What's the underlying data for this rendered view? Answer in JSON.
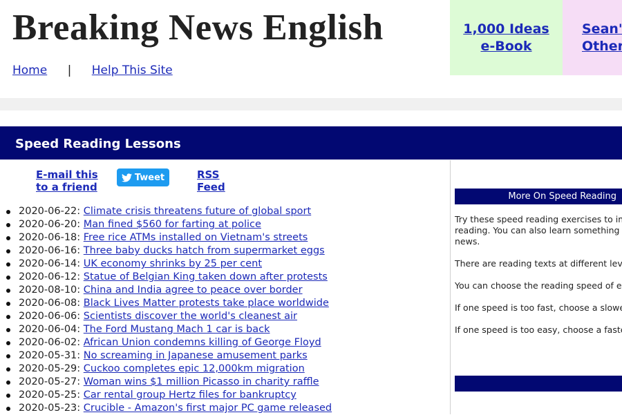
{
  "header": {
    "site_title": "Breaking News English",
    "nav": {
      "home": "Home",
      "separator": "|",
      "help": "Help This Site"
    },
    "promo_ideas": {
      "line1": "1,000 Ideas",
      "line2": "e-Book",
      "bg": "#ddfbd6"
    },
    "promo_sean": {
      "line1": "Sean'",
      "line2": "Other",
      "bg": "#f6ddf6"
    }
  },
  "section": {
    "title": "Speed Reading Lessons",
    "bg": "#020872"
  },
  "share": {
    "email": "E-mail this\nto a friend",
    "tweet": "Tweet",
    "tweet_icon": "twitter-bird-icon",
    "rss": "RSS\nFeed"
  },
  "lessons": [
    {
      "date": "2020-06-22:",
      "title": "Climate crisis threatens future of global sport"
    },
    {
      "date": "2020-06-20:",
      "title": "Man fined $560 for farting at police"
    },
    {
      "date": "2020-06-18:",
      "title": "Free rice ATMs installed on Vietnam's streets"
    },
    {
      "date": "2020-06-16:",
      "title": "Three baby ducks hatch from supermarket eggs"
    },
    {
      "date": "2020-06-14:",
      "title": "UK economy shrinks by 25 per cent"
    },
    {
      "date": "2020-06-12:",
      "title": "Statue of Belgian King taken down after protests"
    },
    {
      "date": "2020-08-10:",
      "title": "China and India agree to peace over border"
    },
    {
      "date": "2020-06-08:",
      "title": "Black Lives Matter protests take place worldwide"
    },
    {
      "date": "2020-06-06:",
      "title": "Scientists discover the world's cleanest air"
    },
    {
      "date": "2020-06-04:",
      "title": "The Ford Mustang Mach 1 car is back"
    },
    {
      "date": "2020-06-02:",
      "title": "African Union condemns killing of George Floyd"
    },
    {
      "date": "2020-05-31:",
      "title": "No screaming in Japanese amusement parks"
    },
    {
      "date": "2020-05-29:",
      "title": "Cuckoo completes epic 12,000km migration"
    },
    {
      "date": "2020-05-27:",
      "title": "Woman wins $1 million Picasso in charity raffle"
    },
    {
      "date": "2020-05-25:",
      "title": "Car rental group Hertz files for bankruptcy"
    },
    {
      "date": "2020-05-23:",
      "title": "Crucible - Amazon's first major PC game released"
    }
  ],
  "sidebar": {
    "heading": "More On Speed Reading",
    "paragraphs": [
      "Try these speed reading exercises to imp\nreading. You can also learn something a\nnews.",
      "There are reading texts at different level",
      "You can choose the reading speed of ea",
      "If one speed is too fast, choose a slower",
      "If one speed is too easy, choose a faster"
    ]
  }
}
